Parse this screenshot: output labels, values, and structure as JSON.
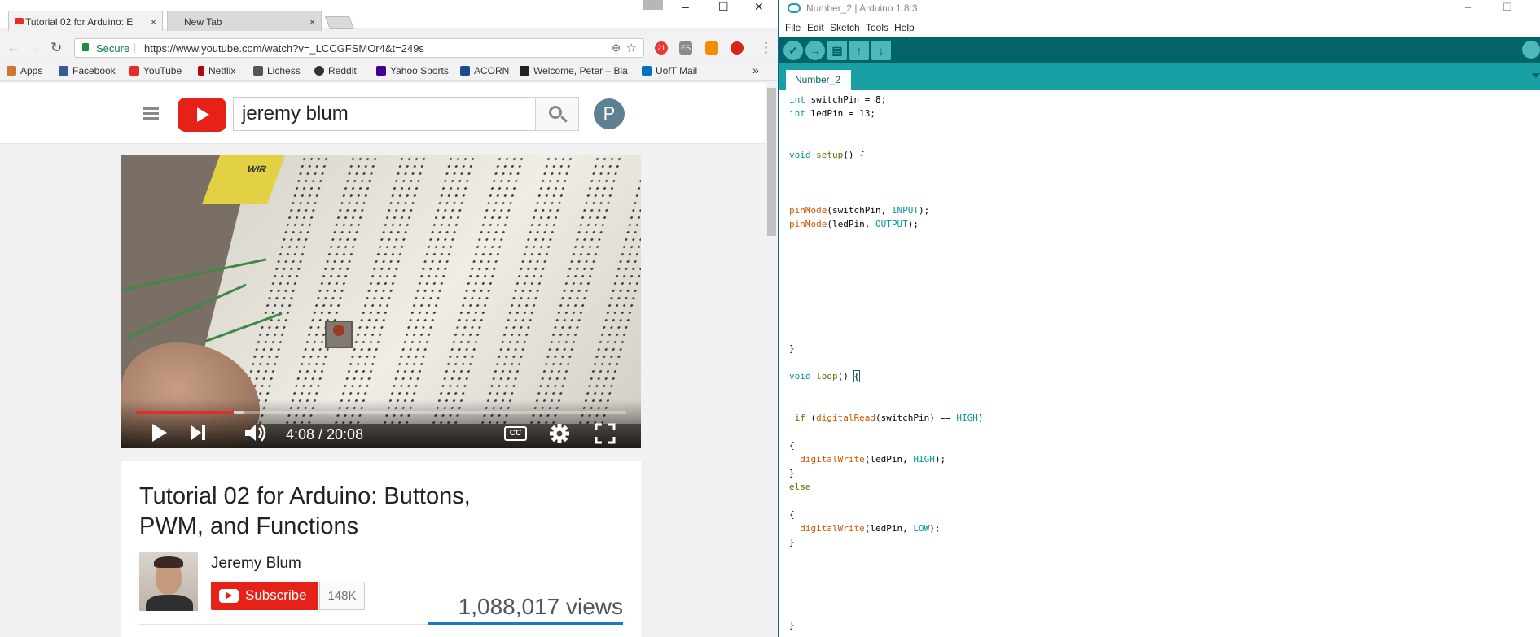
{
  "chrome": {
    "tabs": [
      {
        "label": "Tutorial 02 for Arduino: E",
        "close": "×"
      },
      {
        "label": "New Tab",
        "close": "×"
      }
    ],
    "window_controls": {
      "minimize": "–",
      "maximize": "☐",
      "close": "✕"
    },
    "nav": {
      "back": "←",
      "forward": "→",
      "reload": "↻"
    },
    "omnibox": {
      "secure_label": "Secure",
      "url": "https://www.youtube.com/watch?v=_LCCGFSMOr4&t=249s",
      "zoom_icon": "magnifier-icon",
      "star": "☆"
    },
    "extensions": {
      "badge_count": "21",
      "es_label": "ES",
      "menu": "⋮"
    },
    "bookmarks": [
      {
        "label": "Apps",
        "color": "#e44"
      },
      {
        "label": "Facebook",
        "color": "#3b5998"
      },
      {
        "label": "YouTube",
        "color": "#e52d27"
      },
      {
        "label": "Netflix",
        "color": "#b20710"
      },
      {
        "label": "Lichess",
        "color": "#555555"
      },
      {
        "label": "Reddit",
        "color": "#333333"
      },
      {
        "label": "Yahoo Sports",
        "color": "#400090"
      },
      {
        "label": "ACORN",
        "color": "#1e4b8f"
      },
      {
        "label": "Welcome, Peter – Bla",
        "color": "#222222"
      },
      {
        "label": "UofT Mail",
        "color": "#0072c6"
      }
    ],
    "bookmarks_overflow": "»"
  },
  "youtube": {
    "search_query": "jeremy blum",
    "avatar_letter": "P",
    "player": {
      "time": "4:08 / 20:08",
      "progress_fraction": 0.2,
      "buffer_fraction": 0.02,
      "box_label": "WIR",
      "cc_label": "CC"
    },
    "video_title": "Tutorial 02 for Arduino: Buttons, PWM, and Functions",
    "channel_name": "Jeremy Blum",
    "subscribe_label": "Subscribe",
    "subscriber_count": "148K",
    "views": "1,088,017 views"
  },
  "arduino": {
    "title": "Number_2 | Arduino 1.8.3",
    "window_controls": {
      "minimize": "–",
      "maximize": "☐"
    },
    "menu": [
      "File",
      "Edit",
      "Sketch",
      "Tools",
      "Help"
    ],
    "tab_label": "Number_2",
    "colors": {
      "toolbar": "#006468",
      "tabs": "#17a1a5",
      "keyword": "#00979c",
      "function": "#d35400"
    }
  }
}
